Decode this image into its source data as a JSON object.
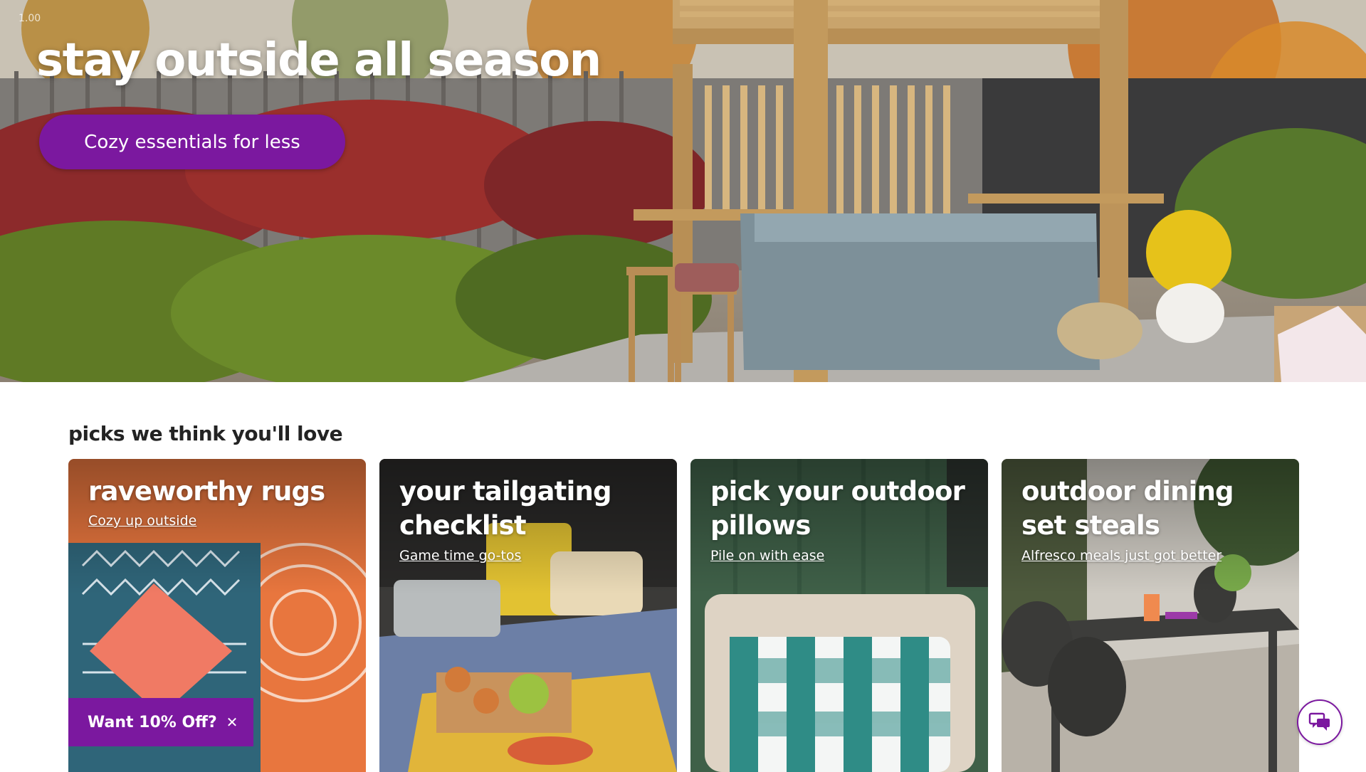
{
  "hero": {
    "zoom_label": "1.00",
    "title": "stay outside all season",
    "cta_label": "Cozy essentials for less"
  },
  "picks": {
    "title": "picks we think you'll love",
    "cards": [
      {
        "title": "raveworthy rugs",
        "link": "Cozy up outside"
      },
      {
        "title": "your tailgating checklist",
        "link": "Game time go-tos"
      },
      {
        "title": "pick your outdoor pillows",
        "link": "Pile on with ease"
      },
      {
        "title": "outdoor dining set steals",
        "link": "Alfresco meals just got better"
      }
    ]
  },
  "promo": {
    "label": "Want 10% Off?",
    "close_icon": "close-icon"
  },
  "chat": {
    "icon": "chat-bubbles-icon"
  },
  "colors": {
    "brand": "#7b189f",
    "text": "#232323"
  }
}
